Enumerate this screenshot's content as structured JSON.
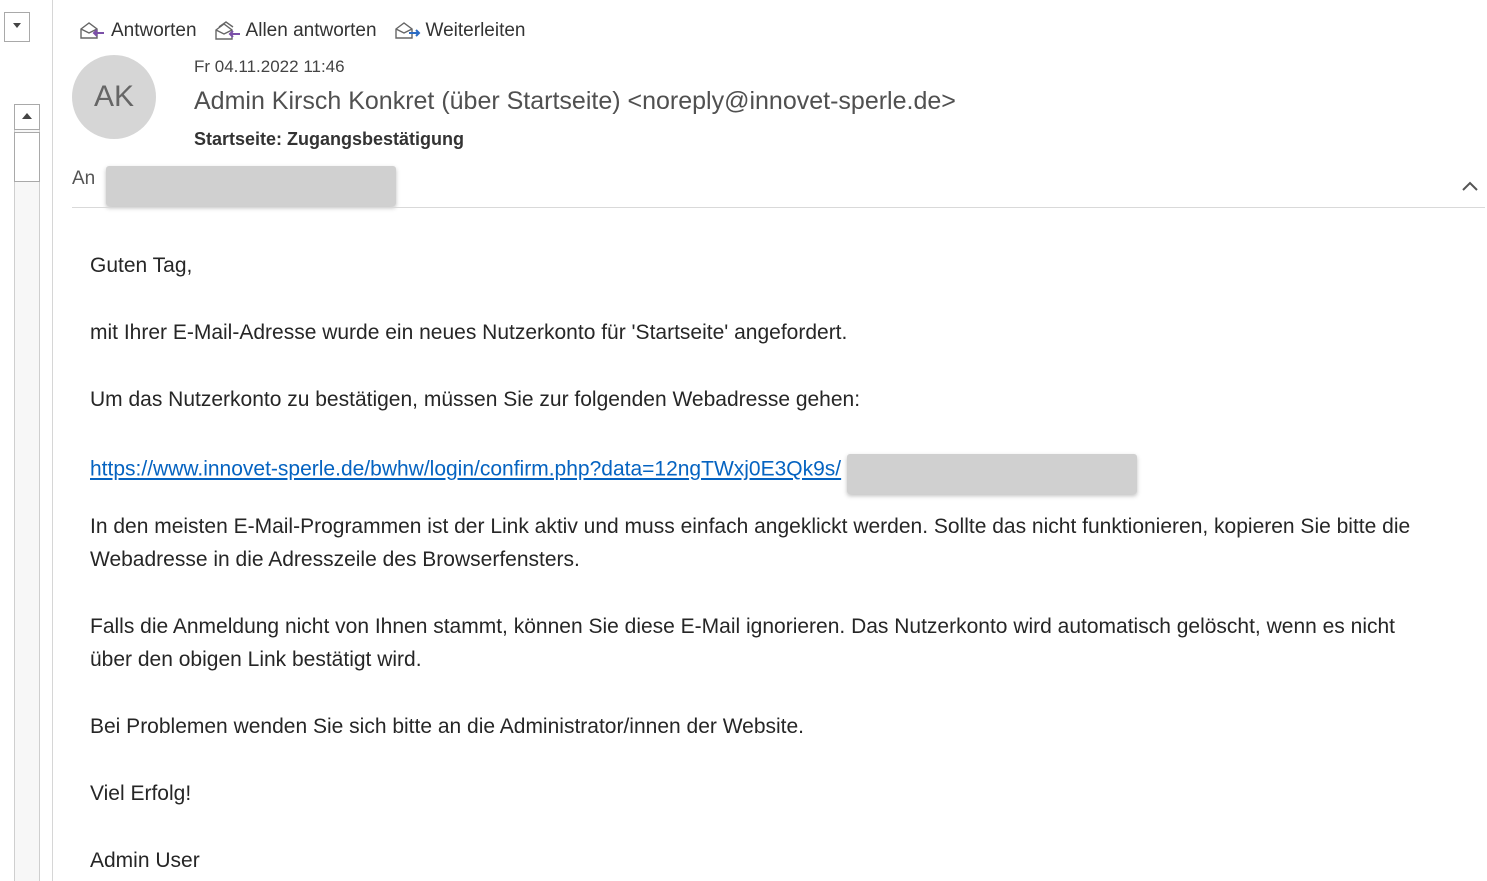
{
  "toolbar": {
    "reply_label": "Antworten",
    "reply_all_label": "Allen antworten",
    "forward_label": "Weiterleiten",
    "icons": [
      "reply-icon",
      "reply-all-icon",
      "forward-icon"
    ]
  },
  "header": {
    "avatar_initials": "AK",
    "date": "Fr 04.11.2022 11:46",
    "sender": "Admin Kirsch Konkret (über Startseite) <noreply@innovet-sperle.de>",
    "subject": "Startseite: Zugangsbestätigung",
    "to_label": "An"
  },
  "body": {
    "greeting": "Guten Tag,",
    "para1": "mit Ihrer E-Mail-Adresse wurde ein neues Nutzerkonto für 'Startseite' angefordert.",
    "para2": "Um das Nutzerkonto zu bestätigen, müssen Sie zur folgenden Webadresse gehen:",
    "link": "https://www.innovet-sperle.de/bwhw/login/confirm.php?data=12ngTWxj0E3Qk9s/",
    "para3": "In den meisten E-Mail-Programmen ist der Link aktiv und muss einfach angeklickt werden. Sollte das nicht funktionieren, kopieren Sie bitte die Webadresse in die Adresszeile des Browserfensters.",
    "para4": "Falls die Anmeldung nicht von Ihnen stammt, können Sie diese E-Mail ignorieren. Das Nutzerkonto wird automatisch gelöscht, wenn es nicht über den obigen Link bestätigt wird.",
    "para5": "Bei Problemen wenden Sie sich bitte an die Administrator/innen der Website.",
    "closing": "Viel Erfolg!",
    "signature": "Admin User"
  },
  "colors": {
    "link": "#0563c1",
    "avatar_bg": "#d6d6d6",
    "reply_arrow": "#7b4fa8",
    "forward_arrow": "#2b6cc4"
  }
}
